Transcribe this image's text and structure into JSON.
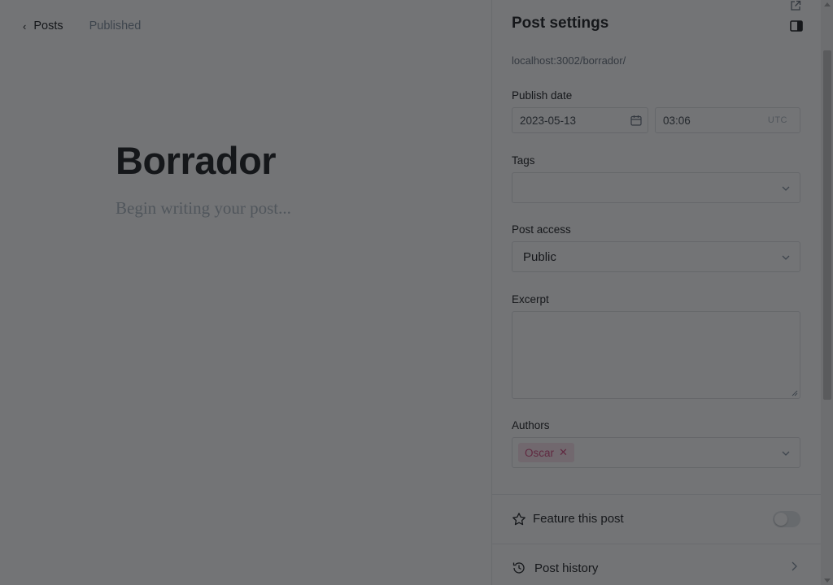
{
  "editor": {
    "back_label": "Posts",
    "status": "Published",
    "title": "Borrador",
    "body_placeholder": "Begin writing your post..."
  },
  "settings": {
    "title": "Post settings",
    "slug_preview": "localhost:3002/borrador/",
    "publish_date": {
      "label": "Publish date",
      "date": "2023-05-13",
      "time": "03:06",
      "timezone": "UTC"
    },
    "tags": {
      "label": "Tags",
      "value": ""
    },
    "post_access": {
      "label": "Post access",
      "value": "Public"
    },
    "excerpt": {
      "label": "Excerpt",
      "value": ""
    },
    "authors": {
      "label": "Authors",
      "items": [
        "Oscar"
      ]
    },
    "feature": {
      "label": "Feature this post",
      "enabled": false
    },
    "history": {
      "label": "Post history"
    }
  },
  "colors": {
    "overlay": "#15171a",
    "chip_bg": "#fbe2ea",
    "chip_text": "#d0457a",
    "border": "#dcdfe2"
  },
  "icons": {
    "back": "chevron-left-icon",
    "external": "external-link-icon",
    "sidebar": "sidebar-toggle-icon",
    "calendar": "calendar-icon",
    "caret": "chevron-down-icon",
    "remove": "close-icon",
    "star": "star-icon",
    "history": "history-icon",
    "forward": "chevron-right-icon"
  }
}
